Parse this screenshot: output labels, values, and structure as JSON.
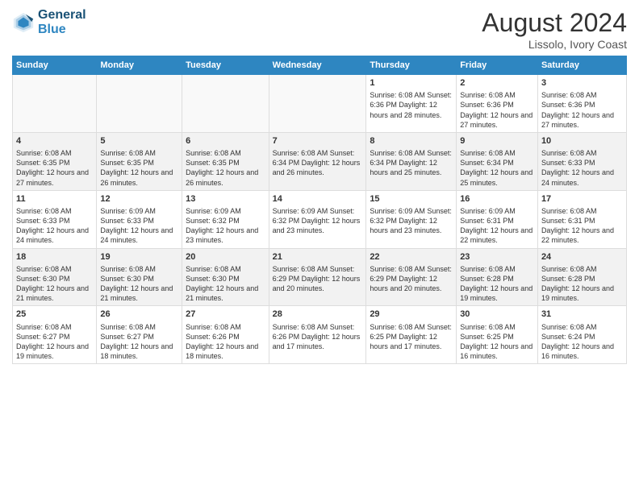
{
  "header": {
    "logo_line1": "General",
    "logo_line2": "Blue",
    "main_title": "August 2024",
    "subtitle": "Lissolo, Ivory Coast"
  },
  "days_of_week": [
    "Sunday",
    "Monday",
    "Tuesday",
    "Wednesday",
    "Thursday",
    "Friday",
    "Saturday"
  ],
  "weeks": [
    [
      {
        "day": "",
        "content": ""
      },
      {
        "day": "",
        "content": ""
      },
      {
        "day": "",
        "content": ""
      },
      {
        "day": "",
        "content": ""
      },
      {
        "day": "1",
        "content": "Sunrise: 6:08 AM\nSunset: 6:36 PM\nDaylight: 12 hours\nand 28 minutes."
      },
      {
        "day": "2",
        "content": "Sunrise: 6:08 AM\nSunset: 6:36 PM\nDaylight: 12 hours\nand 27 minutes."
      },
      {
        "day": "3",
        "content": "Sunrise: 6:08 AM\nSunset: 6:36 PM\nDaylight: 12 hours\nand 27 minutes."
      }
    ],
    [
      {
        "day": "4",
        "content": "Sunrise: 6:08 AM\nSunset: 6:35 PM\nDaylight: 12 hours\nand 27 minutes."
      },
      {
        "day": "5",
        "content": "Sunrise: 6:08 AM\nSunset: 6:35 PM\nDaylight: 12 hours\nand 26 minutes."
      },
      {
        "day": "6",
        "content": "Sunrise: 6:08 AM\nSunset: 6:35 PM\nDaylight: 12 hours\nand 26 minutes."
      },
      {
        "day": "7",
        "content": "Sunrise: 6:08 AM\nSunset: 6:34 PM\nDaylight: 12 hours\nand 26 minutes."
      },
      {
        "day": "8",
        "content": "Sunrise: 6:08 AM\nSunset: 6:34 PM\nDaylight: 12 hours\nand 25 minutes."
      },
      {
        "day": "9",
        "content": "Sunrise: 6:08 AM\nSunset: 6:34 PM\nDaylight: 12 hours\nand 25 minutes."
      },
      {
        "day": "10",
        "content": "Sunrise: 6:08 AM\nSunset: 6:33 PM\nDaylight: 12 hours\nand 24 minutes."
      }
    ],
    [
      {
        "day": "11",
        "content": "Sunrise: 6:08 AM\nSunset: 6:33 PM\nDaylight: 12 hours\nand 24 minutes."
      },
      {
        "day": "12",
        "content": "Sunrise: 6:09 AM\nSunset: 6:33 PM\nDaylight: 12 hours\nand 24 minutes."
      },
      {
        "day": "13",
        "content": "Sunrise: 6:09 AM\nSunset: 6:32 PM\nDaylight: 12 hours\nand 23 minutes."
      },
      {
        "day": "14",
        "content": "Sunrise: 6:09 AM\nSunset: 6:32 PM\nDaylight: 12 hours\nand 23 minutes."
      },
      {
        "day": "15",
        "content": "Sunrise: 6:09 AM\nSunset: 6:32 PM\nDaylight: 12 hours\nand 23 minutes."
      },
      {
        "day": "16",
        "content": "Sunrise: 6:09 AM\nSunset: 6:31 PM\nDaylight: 12 hours\nand 22 minutes."
      },
      {
        "day": "17",
        "content": "Sunrise: 6:08 AM\nSunset: 6:31 PM\nDaylight: 12 hours\nand 22 minutes."
      }
    ],
    [
      {
        "day": "18",
        "content": "Sunrise: 6:08 AM\nSunset: 6:30 PM\nDaylight: 12 hours\nand 21 minutes."
      },
      {
        "day": "19",
        "content": "Sunrise: 6:08 AM\nSunset: 6:30 PM\nDaylight: 12 hours\nand 21 minutes."
      },
      {
        "day": "20",
        "content": "Sunrise: 6:08 AM\nSunset: 6:30 PM\nDaylight: 12 hours\nand 21 minutes."
      },
      {
        "day": "21",
        "content": "Sunrise: 6:08 AM\nSunset: 6:29 PM\nDaylight: 12 hours\nand 20 minutes."
      },
      {
        "day": "22",
        "content": "Sunrise: 6:08 AM\nSunset: 6:29 PM\nDaylight: 12 hours\nand 20 minutes."
      },
      {
        "day": "23",
        "content": "Sunrise: 6:08 AM\nSunset: 6:28 PM\nDaylight: 12 hours\nand 19 minutes."
      },
      {
        "day": "24",
        "content": "Sunrise: 6:08 AM\nSunset: 6:28 PM\nDaylight: 12 hours\nand 19 minutes."
      }
    ],
    [
      {
        "day": "25",
        "content": "Sunrise: 6:08 AM\nSunset: 6:27 PM\nDaylight: 12 hours\nand 19 minutes."
      },
      {
        "day": "26",
        "content": "Sunrise: 6:08 AM\nSunset: 6:27 PM\nDaylight: 12 hours\nand 18 minutes."
      },
      {
        "day": "27",
        "content": "Sunrise: 6:08 AM\nSunset: 6:26 PM\nDaylight: 12 hours\nand 18 minutes."
      },
      {
        "day": "28",
        "content": "Sunrise: 6:08 AM\nSunset: 6:26 PM\nDaylight: 12 hours\nand 17 minutes."
      },
      {
        "day": "29",
        "content": "Sunrise: 6:08 AM\nSunset: 6:25 PM\nDaylight: 12 hours\nand 17 minutes."
      },
      {
        "day": "30",
        "content": "Sunrise: 6:08 AM\nSunset: 6:25 PM\nDaylight: 12 hours\nand 16 minutes."
      },
      {
        "day": "31",
        "content": "Sunrise: 6:08 AM\nSunset: 6:24 PM\nDaylight: 12 hours\nand 16 minutes."
      }
    ]
  ]
}
